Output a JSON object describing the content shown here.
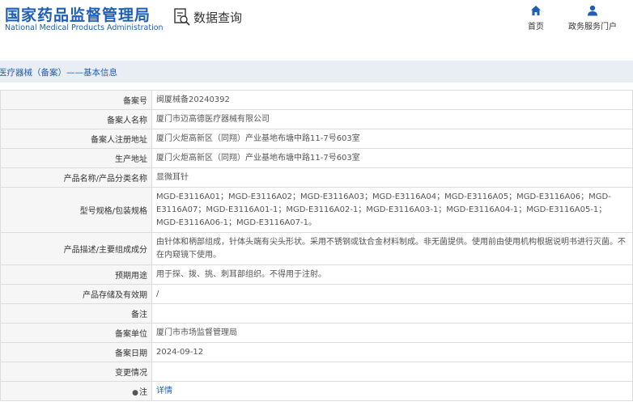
{
  "header": {
    "logo_cn": "国家药品监督管理局",
    "logo_en": "National Medical Products Administration",
    "query_title": "数据查询",
    "nav": [
      {
        "label": "首页",
        "icon": "home-icon"
      },
      {
        "label": "政务服务门户",
        "icon": "user-icon"
      }
    ]
  },
  "breadcrumb": "医疗器械（备案）——基本信息",
  "colors": {
    "brand": "#1e5eb6",
    "crumb_bg": "#e9eef5",
    "label_bg": "#f6f6f6"
  },
  "rows": [
    {
      "label": "备案号",
      "value": "闽厦械备20240392"
    },
    {
      "label": "备案人名称",
      "value": "厦门市迈高德医疗器械有限公司"
    },
    {
      "label": "备案人注册地址",
      "value": "厦门火炬高新区（同翔）产业基地布塘中路11-7号603室"
    },
    {
      "label": "生产地址",
      "value": "厦门火炬高新区（同翔）产业基地布塘中路11-7号603室"
    },
    {
      "label": "产品名称/产品分类名称",
      "value": "显微耳针"
    },
    {
      "label": "型号规格/包装规格",
      "value": "MGD-E3116A01；MGD-E3116A02；MGD-E3116A03；MGD-E3116A04；MGD-E3116A05；MGD-E3116A06；MGD-E3116A07；MGD-E3116A01-1；MGD-E3116A02-1；MGD-E3116A03-1；MGD-E3116A04-1；MGD-E3116A05-1；MGD-E3116A06-1；MGD-E3116A07-1。"
    },
    {
      "label": "产品描述/主要组成成分",
      "value": "由针体和柄部组成，针体头端有尖头形状。采用不锈钢或钛合金材料制成。非无菌提供。使用前由使用机构根据说明书进行灭菌。不在内窥镜下使用。"
    },
    {
      "label": "预期用途",
      "value": "用于探、拨、挑、刺耳部组织。不得用于注射。"
    },
    {
      "label": "产品存储及有效期",
      "value": "/"
    },
    {
      "label": "备注",
      "value": ""
    },
    {
      "label": "备案单位",
      "value": "厦门市市场监督管理局"
    },
    {
      "label": "备案日期",
      "value": "2024-09-12"
    },
    {
      "label": "变更情况",
      "value": ""
    }
  ],
  "note_row": {
    "label": "注",
    "pin_icon": "pin-icon",
    "link": "详情"
  }
}
